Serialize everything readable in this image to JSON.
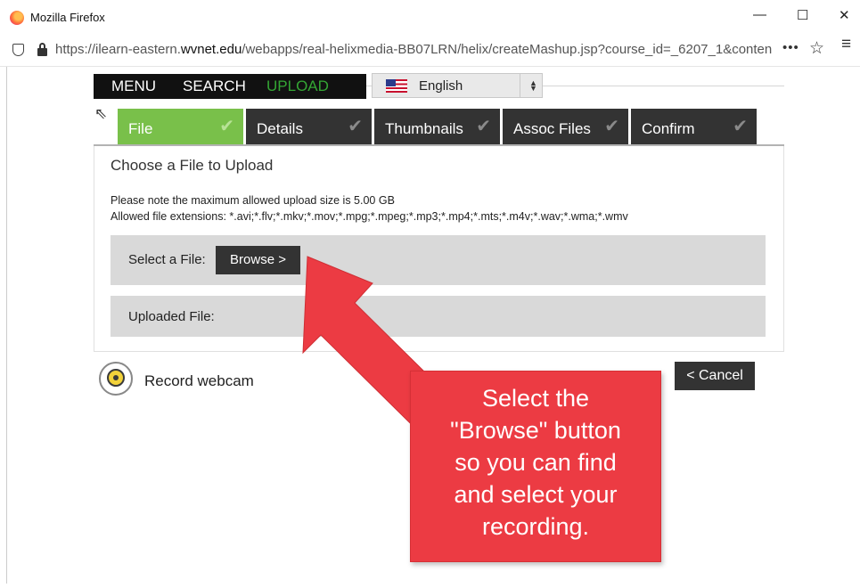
{
  "window": {
    "title": "Mozilla Firefox",
    "minimize": "—",
    "maximize": "☐",
    "close": "✕"
  },
  "address_bar": {
    "url_prefix": "https://ilearn-eastern.",
    "url_domain": "wvnet.edu",
    "url_suffix": "/webapps/real-helixmedia-BB07LRN/helix/createMashup.jsp?course_id=_6207_1&conten",
    "more_actions": "•••",
    "bookmark_star": "☆",
    "menu": "≡"
  },
  "nav": {
    "menu": "MENU",
    "search": "SEARCH",
    "upload": "UPLOAD"
  },
  "language": {
    "selected": "English",
    "flag_icon": "us-flag-icon"
  },
  "tabs": [
    {
      "label": "File",
      "check": "✔"
    },
    {
      "label": "Details",
      "check": "✔"
    },
    {
      "label": "Thumbnails",
      "check": "✔"
    },
    {
      "label": "Assoc Files",
      "check": "✔"
    },
    {
      "label": "Confirm",
      "check": "✔"
    }
  ],
  "panel": {
    "title": "Choose a File to Upload",
    "max_size_note": "Please note the maximum allowed upload size is 5.00 GB",
    "extensions_note": "Allowed file extensions: *.avi;*.flv;*.mkv;*.mov;*.mpg;*.mpeg;*.mp3;*.mp4;*.mts;*.m4v;*.wav;*.wma;*.wmv",
    "select_label": "Select a File:",
    "browse_label": "Browse >",
    "uploaded_label": "Uploaded File:"
  },
  "webcam_label": "Record webcam",
  "cancel_label": "< Cancel",
  "callout": {
    "text": "Select the\n\"Browse\" button\nso you can find\nand select your\nrecording."
  },
  "colors": {
    "active_tab": "#79c04a",
    "tab_dark": "#333333",
    "upload_green": "#34a634",
    "callout_red": "#ec3b43"
  }
}
